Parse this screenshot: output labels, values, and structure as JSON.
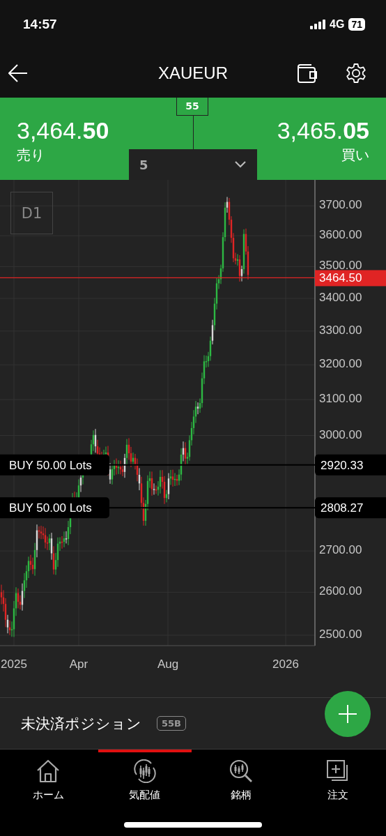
{
  "status_bar": {
    "time": "14:57",
    "network": "4G",
    "battery": "71"
  },
  "nav": {
    "title": "XAUEUR"
  },
  "quote": {
    "sell": {
      "price": "3,464.",
      "pips": "50",
      "label": "売り"
    },
    "buy": {
      "price": "3,465.",
      "pips": "05",
      "label": "買い"
    },
    "spread": "55",
    "lot": "5"
  },
  "chart": {
    "timeframe": "D1",
    "current_price": "3464.50",
    "yticks": [
      "3700.00",
      "3600.00",
      "3500.00",
      "3400.00",
      "3300.00",
      "3200.00",
      "3100.00",
      "3000.00",
      "2700.00",
      "2600.00",
      "2500.00"
    ],
    "xlabels": [
      "2025",
      "Apr",
      "Aug",
      "2026"
    ],
    "orders": [
      {
        "label": "BUY 50.00 Lots",
        "price": "2920.33"
      },
      {
        "label": "BUY 50.00 Lots",
        "price": "2808.27"
      }
    ]
  },
  "positions": {
    "title": "未決済ポジション",
    "badge": "55B"
  },
  "tabs": [
    {
      "label": "ホーム",
      "selected": false
    },
    {
      "label": "気配値",
      "selected": true
    },
    {
      "label": "銘柄",
      "selected": false
    },
    {
      "label": "注文",
      "selected": false
    }
  ]
}
